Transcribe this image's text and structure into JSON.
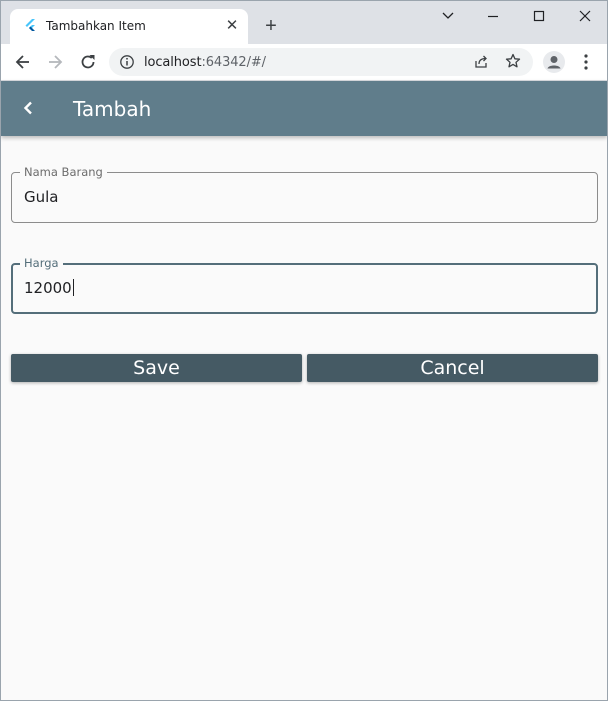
{
  "browser": {
    "tab_title": "Tambahkan Item",
    "url_host": "localhost",
    "url_rest": ":64342/#/"
  },
  "icons": {
    "favicon": "flutter-icon",
    "close_tab": "close-icon",
    "new_tab": "plus-icon",
    "back": "arrow-left-icon",
    "forward": "arrow-right-icon",
    "reload": "reload-icon",
    "info": "info-icon",
    "share": "share-icon",
    "bookmark": "star-icon",
    "profile": "person-icon",
    "menu": "kebab-menu-icon"
  },
  "appbar": {
    "title": "Tambah"
  },
  "form": {
    "nama_label": "Nama Barang",
    "nama_value": "Gula",
    "harga_label": "Harga",
    "harga_value": "12000",
    "save_label": "Save",
    "cancel_label": "Cancel"
  },
  "colors": {
    "appbar": "#607d8b",
    "button": "#455a64",
    "focus": "#546e7a",
    "background": "#fafafa"
  }
}
